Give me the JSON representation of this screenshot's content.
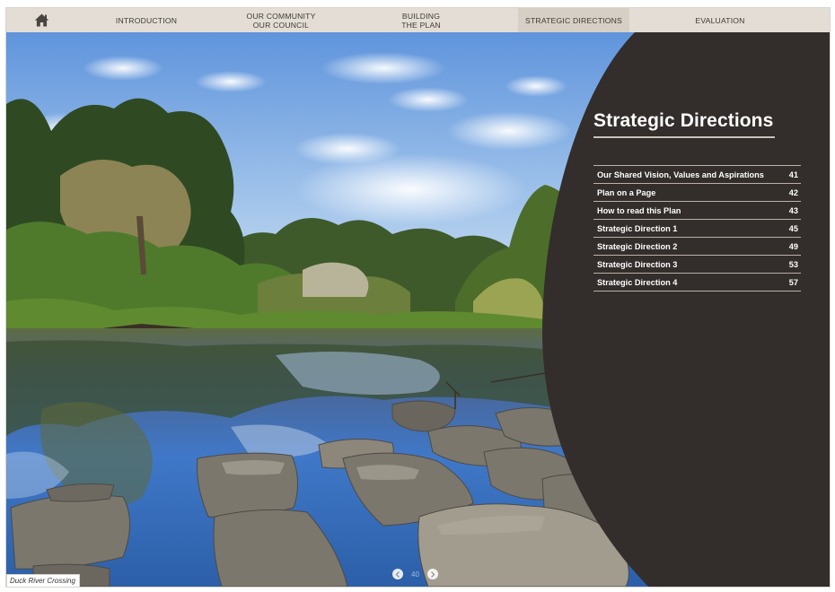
{
  "nav": {
    "home_icon": "home-icon",
    "items": [
      {
        "label": "INTRODUCTION"
      },
      {
        "label": "OUR COMMUNITY\nOUR COUNCIL"
      },
      {
        "label": "BUILDING\nTHE PLAN"
      },
      {
        "label": "STRATEGIC DIRECTIONS"
      },
      {
        "label": "EVALUATION"
      }
    ],
    "active": "STRATEGIC DIRECTIONS"
  },
  "panel": {
    "title": "Strategic Directions",
    "toc": [
      {
        "label": "Our Shared Vision, Values and Aspirations",
        "page": "41"
      },
      {
        "label": "Plan on a Page",
        "page": "42"
      },
      {
        "label": "How to read this Plan",
        "page": "43"
      },
      {
        "label": "Strategic Direction 1",
        "page": "45"
      },
      {
        "label": "Strategic Direction 2",
        "page": "49"
      },
      {
        "label": "Strategic Direction 3",
        "page": "53"
      },
      {
        "label": "Strategic Direction 4",
        "page": "57"
      }
    ]
  },
  "photo": {
    "caption": "Duck River Crossing"
  },
  "pager": {
    "page_number": "40",
    "prev_icon": "chevron-left-icon",
    "next_icon": "chevron-right-icon"
  },
  "colors": {
    "panel": "#332d2b",
    "nav_bg": "#e3ddd5",
    "nav_active": "#d6cfc6",
    "sky": "#8fb6e4"
  }
}
